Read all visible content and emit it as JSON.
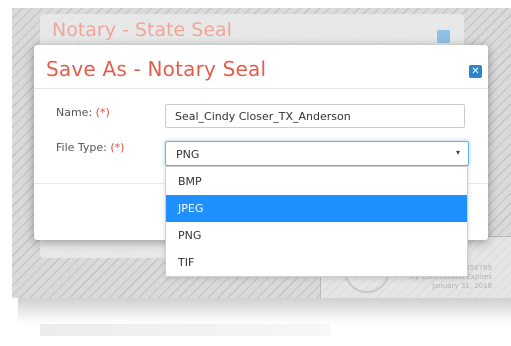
{
  "background": {
    "under_title": "Notary - State Seal",
    "seal_text": [
      "Notary ID 123456789",
      "My Commission Expires",
      "January 31, 2018"
    ]
  },
  "dialog": {
    "title": "Save As - Notary Seal",
    "close_icon": "close-icon",
    "name_label": "Name:",
    "name_required": "(*)",
    "name_value": "Seal_Cindy Closer_TX_Anderson",
    "file_type_label": "File Type:",
    "file_type_required": "(*)",
    "file_type_value": "PNG",
    "caret": "▾",
    "options": [
      {
        "label": "BMP",
        "selected": false
      },
      {
        "label": "JPEG",
        "selected": true
      },
      {
        "label": "PNG",
        "selected": false
      },
      {
        "label": "TIF",
        "selected": false
      }
    ]
  },
  "colors": {
    "title": "#e35d4c",
    "required": "#e24a3b",
    "close_bg": "#2e86c9",
    "selected_bg": "#1e90ff",
    "focus_border": "#66afe9"
  }
}
